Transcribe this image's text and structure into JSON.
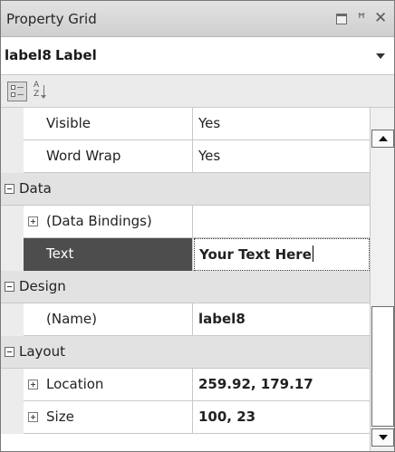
{
  "title_bar": {
    "title": "Property Grid",
    "icons": [
      "window-position-icon",
      "pin-icon",
      "close-icon"
    ],
    "close_glyph": "✕",
    "pin_glyph": "ᵽ"
  },
  "object_selector": {
    "name": "label8",
    "type": "Label"
  },
  "toolbar": {
    "buttons": [
      "categorized-view-icon",
      "alphabetical-sort-icon"
    ],
    "alpha_glyph": "A\nZ"
  },
  "rows": {
    "visible": {
      "name": "Visible",
      "value": "Yes"
    },
    "word_wrap": {
      "name": "Word Wrap",
      "value": "Yes"
    },
    "data_cat": {
      "label": "Data"
    },
    "data_bindings": {
      "name": "(Data Bindings)",
      "value": ""
    },
    "text": {
      "name": "Text",
      "value": "Your Text Here"
    },
    "design_cat": {
      "label": "Design"
    },
    "name_prop": {
      "name": "(Name)",
      "value": "label8"
    },
    "layout_cat": {
      "label": "Layout"
    },
    "location": {
      "name": "Location",
      "value": "259.92, 179.17"
    },
    "size": {
      "name": "Size",
      "value": "100, 23"
    }
  },
  "colors": {
    "selected_row_bg": "#4d4d4d",
    "category_bg": "#e2e2e2",
    "gutter_bg": "#ececec"
  }
}
